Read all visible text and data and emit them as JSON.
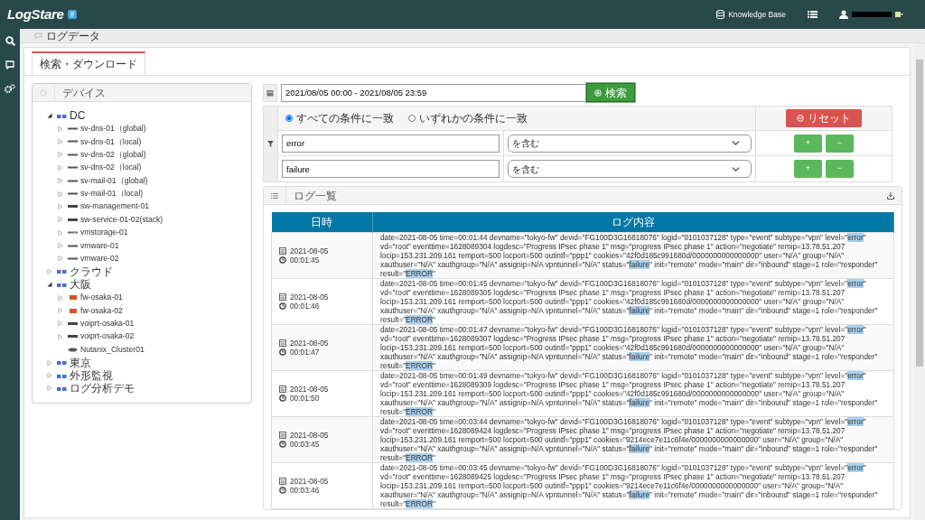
{
  "navbar": {
    "logo": "LogStare",
    "knowledge_base": "Knowledge Base"
  },
  "breadcrumb": "ログデータ",
  "tabs": [
    {
      "label": "検索・ダウンロード",
      "selected": true
    }
  ],
  "devices": {
    "title": "デバイス",
    "tree": [
      {
        "label": "DC",
        "kind": "group",
        "expanded": true,
        "children": [
          {
            "label": "sv-dns-01（global)",
            "kind": "server",
            "expanded": false
          },
          {
            "label": "sv-dns-01（local)",
            "kind": "server",
            "expanded": false
          },
          {
            "label": "sv-dns-02（global)",
            "kind": "server",
            "expanded": false
          },
          {
            "label": "sv-dns-02（local)",
            "kind": "server",
            "expanded": false
          },
          {
            "label": "sv-mail-01（global)",
            "kind": "server",
            "expanded": false
          },
          {
            "label": "sv-mail-01（local)",
            "kind": "server",
            "expanded": false
          },
          {
            "label": "sw-management-01",
            "kind": "switch",
            "expanded": false
          },
          {
            "label": "sw-service-01-02(stack)",
            "kind": "switch",
            "expanded": false
          },
          {
            "label": "vmstorage-01",
            "kind": "storage",
            "expanded": false
          },
          {
            "label": "vmware-01",
            "kind": "server",
            "expanded": false
          },
          {
            "label": "vmware-02",
            "kind": "server",
            "expanded": false
          }
        ]
      },
      {
        "label": "クラウド",
        "kind": "group",
        "expanded": false
      },
      {
        "label": "大阪",
        "kind": "group",
        "expanded": true,
        "children": [
          {
            "label": "fw-osaka-01",
            "kind": "firewall",
            "expanded": false
          },
          {
            "label": "fw-osaka-02",
            "kind": "firewall",
            "expanded": false
          },
          {
            "label": "voiprt-osaka-01",
            "kind": "switch",
            "expanded": false
          },
          {
            "label": "voiprt-osaka-02",
            "kind": "switch",
            "expanded": false
          },
          {
            "label": "Nutanix_Cluster01",
            "kind": "cluster"
          }
        ]
      },
      {
        "label": "東京",
        "kind": "group",
        "expanded": false
      },
      {
        "label": "外形監視",
        "kind": "group",
        "expanded": false
      },
      {
        "label": "ログ分析デモ",
        "kind": "group",
        "expanded": false
      }
    ]
  },
  "search": {
    "date_range": "2021/08/05 00:00 - 2021/08/05 23:59",
    "search_button": "検索",
    "reset_button": "リセット",
    "match_options": [
      {
        "label": "すべての条件に一致",
        "selected": true
      },
      {
        "label": "いずれかの条件に一致",
        "selected": false
      }
    ],
    "conditions": [
      {
        "value": "error",
        "operator": "を含む",
        "add": "+",
        "remove": "−"
      },
      {
        "value": "failure",
        "operator": "を含む",
        "add": "+",
        "remove": "−"
      }
    ]
  },
  "log_list": {
    "title": "ログ一覧",
    "columns": [
      "日時",
      "ログ内容"
    ],
    "rows": [
      {
        "date": "2021-08-05",
        "time": "00:01:45",
        "segments": [
          {
            "text": "date=2021-08-05 time=00:01:44 devname=\"tokyo-fw\" devid=\"FG100D3G16818076\" logid=\"0101037128\" type=\"event\" subtype=\"vpn\" level=\"",
            "highlight": false
          },
          {
            "text": "error",
            "highlight": true
          },
          {
            "text": "\" vd=\"root\" eventtime=1628089304 logdesc=\"Progress IPsec phase 1\" msg=\"progress IPsec phase 1\" action=\"negotiate\" remip=13.78.51.207 locip=153.231.209.161 remport=500 locport=500 outintf=\"ppp1\" cookies=\"42f0d185c991680d/0000000000000000\" user=\"N/A\" group=\"N/A\" xauthuser=\"N/A\" xauthgroup=\"N/A\" assignip=N/A vpntunnel=\"N/A\" status=\"",
            "highlight": false
          },
          {
            "text": "failure",
            "highlight": true
          },
          {
            "text": "\" init=\"remote\" mode=\"main\" dir=\"inbound\" stage=1 role=\"responder\" result=\"",
            "highlight": false
          },
          {
            "text": "ERROR",
            "highlight": true
          },
          {
            "text": "\"",
            "highlight": false
          }
        ]
      },
      {
        "date": "2021-08-05",
        "time": "00:01:46",
        "segments": [
          {
            "text": "date=2021-08-05 time=00:01:45 devname=\"tokyo-fw\" devid=\"FG100D3G16818076\" logid=\"0101037128\" type=\"event\" subtype=\"vpn\" level=\"",
            "highlight": false
          },
          {
            "text": "error",
            "highlight": true
          },
          {
            "text": "\" vd=\"root\" eventtime=1628089305 logdesc=\"Progress IPsec phase 1\" msg=\"progress IPsec phase 1\" action=\"negotiate\" remip=13.78.51.207 locip=153.231.209.161 remport=500 locport=500 outintf=\"ppp1\" cookies=\"42f0d185c991680d/0000000000000000\" user=\"N/A\" group=\"N/A\" xauthuser=\"N/A\" xauthgroup=\"N/A\" assignip=N/A vpntunnel=\"N/A\" status=\"",
            "highlight": false
          },
          {
            "text": "failure",
            "highlight": true
          },
          {
            "text": "\" init=\"remote\" mode=\"main\" dir=\"inbound\" stage=1 role=\"responder\" result=\"",
            "highlight": false
          },
          {
            "text": "ERROR",
            "highlight": true
          },
          {
            "text": "\"",
            "highlight": false
          }
        ]
      },
      {
        "date": "2021-08-05",
        "time": "00:01:47",
        "segments": [
          {
            "text": "date=2021-08-05 time=00:01:47 devname=\"tokyo-fw\" devid=\"FG100D3G16818076\" logid=\"0101037128\" type=\"event\" subtype=\"vpn\" level=\"",
            "highlight": false
          },
          {
            "text": "error",
            "highlight": true
          },
          {
            "text": "\" vd=\"root\" eventtime=1628089307 logdesc=\"Progress IPsec phase 1\" msg=\"progress IPsec phase 1\" action=\"negotiate\" remip=13.78.51.207 locip=153.231.209.161 remport=500 locport=500 outintf=\"ppp1\" cookies=\"42f0d185c991680d/0000000000000000\" user=\"N/A\" group=\"N/A\" xauthuser=\"N/A\" xauthgroup=\"N/A\" assignip=N/A vpntunnel=\"N/A\" status=\"",
            "highlight": false
          },
          {
            "text": "failure",
            "highlight": true
          },
          {
            "text": "\" init=\"remote\" mode=\"main\" dir=\"inbound\" stage=1 role=\"responder\" result=\"",
            "highlight": false
          },
          {
            "text": "ERROR",
            "highlight": true
          },
          {
            "text": "\"",
            "highlight": false
          }
        ]
      },
      {
        "date": "2021-08-05",
        "time": "00:01:50",
        "segments": [
          {
            "text": "date=2021-08-05 time=00:01:49 devname=\"tokyo-fw\" devid=\"FG100D3G16818076\" logid=\"0101037128\" type=\"event\" subtype=\"vpn\" level=\"",
            "highlight": false
          },
          {
            "text": "error",
            "highlight": true
          },
          {
            "text": "\" vd=\"root\" eventtime=1628089309 logdesc=\"Progress IPsec phase 1\" msg=\"progress IPsec phase 1\" action=\"negotiate\" remip=13.78.51.207 locip=153.231.209.161 remport=500 locport=500 outintf=\"ppp1\" cookies=\"42f0d185c991680d/0000000000000000\" user=\"N/A\" group=\"N/A\" xauthuser=\"N/A\" xauthgroup=\"N/A\" assignip=N/A vpntunnel=\"N/A\" status=\"",
            "highlight": false
          },
          {
            "text": "failure",
            "highlight": true
          },
          {
            "text": "\" init=\"remote\" mode=\"main\" dir=\"inbound\" stage=1 role=\"responder\" result=\"",
            "highlight": false
          },
          {
            "text": "ERROR",
            "highlight": true
          },
          {
            "text": "\"",
            "highlight": false
          }
        ]
      },
      {
        "date": "2021-08-05",
        "time": "00:03:45",
        "segments": [
          {
            "text": "date=2021-08-05 time=00:03:44 devname=\"tokyo-fw\" devid=\"FG100D3G16818076\" logid=\"0101037128\" type=\"event\" subtype=\"vpn\" level=\"",
            "highlight": false
          },
          {
            "text": "error",
            "highlight": true
          },
          {
            "text": "\" vd=\"root\" eventtime=1628089424 logdesc=\"Progress IPsec phase 1\" msg=\"progress IPsec phase 1\" action=\"negotiate\" remip=13.78.51.207 locip=153.231.209.161 remport=500 locport=500 outintf=\"ppp1\" cookies=\"9214ece7e11c6f4e/0000000000000000\" user=\"N/A\" group=\"N/A\" xauthuser=\"N/A\" xauthgroup=\"N/A\" assignip=N/A vpntunnel=\"N/A\" status=\"",
            "highlight": false
          },
          {
            "text": "failure",
            "highlight": true
          },
          {
            "text": "\" init=\"remote\" mode=\"main\" dir=\"inbound\" stage=1 role=\"responder\" result=\"",
            "highlight": false
          },
          {
            "text": "ERROR",
            "highlight": true
          },
          {
            "text": "\"",
            "highlight": false
          }
        ]
      },
      {
        "date": "2021-08-05",
        "time": "00:03:46",
        "segments": [
          {
            "text": "date=2021-08-05 time=00:03:45 devname=\"tokyo-fw\" devid=\"FG100D3G16818076\" logid=\"0101037128\" type=\"event\" subtype=\"vpn\" level=\"",
            "highlight": false
          },
          {
            "text": "error",
            "highlight": true
          },
          {
            "text": "\" vd=\"root\" eventtime=1628089425 logdesc=\"Progress IPsec phase 1\" msg=\"progress IPsec phase 1\" action=\"negotiate\" remip=13.78.51.207 locip=153.231.209.161 remport=500 locport=500 outintf=\"ppp1\" cookies=\"9214ece7e11c6f4e/0000000000000000\" user=\"N/A\" group=\"N/A\" xauthuser=\"N/A\" xauthgroup=\"N/A\" assignip=N/A vpntunnel=\"N/A\" status=\"",
            "highlight": false
          },
          {
            "text": "failure",
            "highlight": true
          },
          {
            "text": "\" init=\"remote\" mode=\"main\" dir=\"inbound\" stage=1 role=\"responder\" result=\"",
            "highlight": false
          },
          {
            "text": "ERROR",
            "highlight": true
          },
          {
            "text": "\"",
            "highlight": false
          }
        ]
      }
    ]
  }
}
